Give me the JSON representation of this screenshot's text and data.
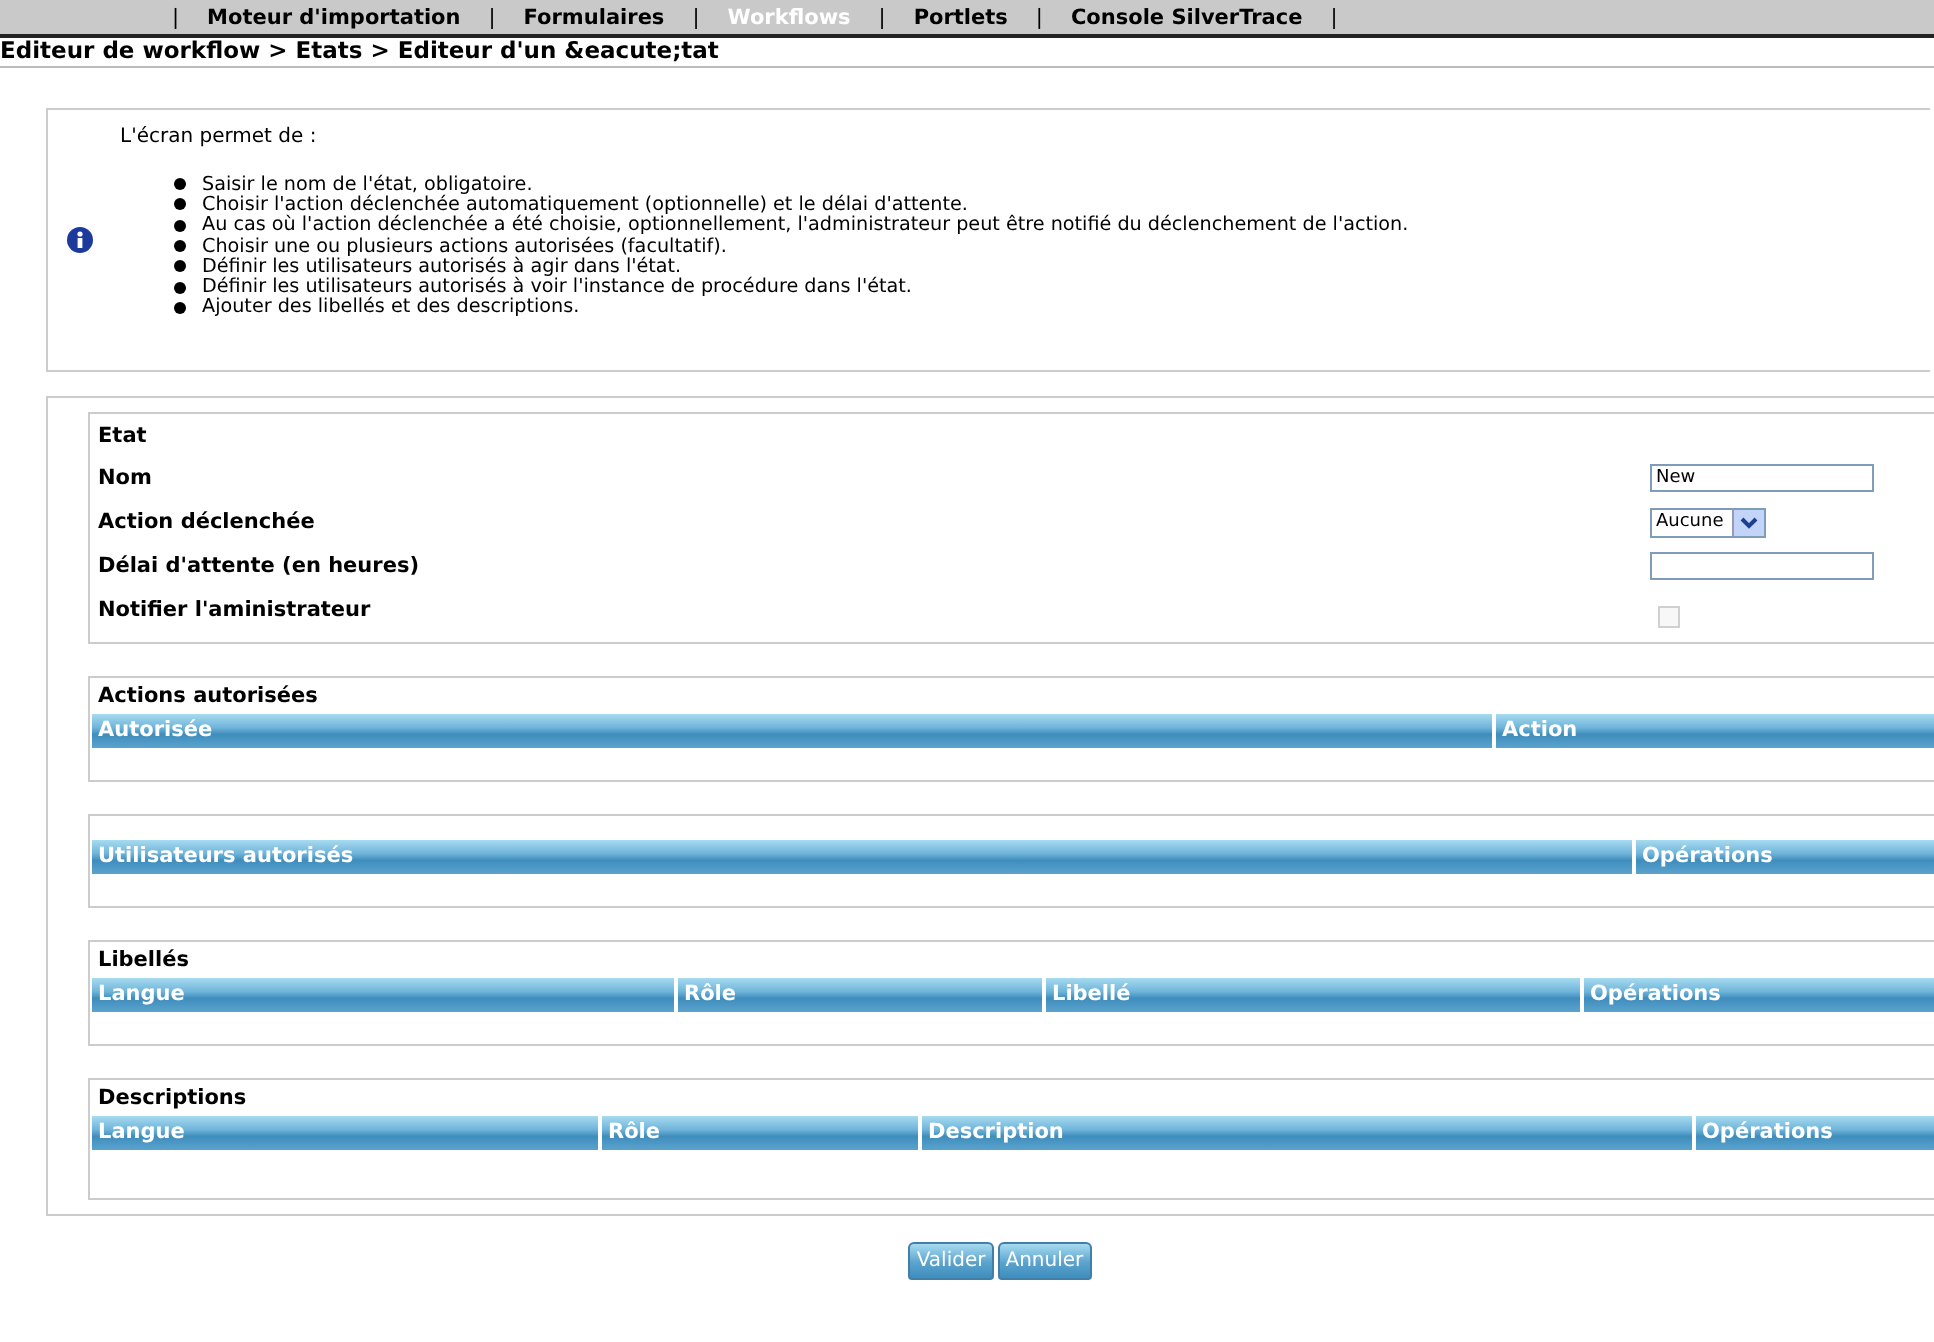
{
  "nav": [
    {
      "kind": "separator",
      "label": "|"
    },
    {
      "kind": "tab",
      "label": "Moteur d'importation",
      "selected": false
    },
    {
      "kind": "separator",
      "label": "|"
    },
    {
      "kind": "tab",
      "label": "Formulaires",
      "selected": false
    },
    {
      "kind": "separator",
      "label": "|"
    },
    {
      "kind": "tab",
      "label": "Workflows",
      "selected": true
    },
    {
      "kind": "separator",
      "label": "|"
    },
    {
      "kind": "tab",
      "label": "Portlets",
      "selected": false
    },
    {
      "kind": "separator",
      "label": "|"
    },
    {
      "kind": "tab",
      "label": "Console SilverTrace",
      "selected": false
    },
    {
      "kind": "separator",
      "label": "|"
    }
  ],
  "breadcrumb": "Editeur de workflow > Etats > Editeur d'un &eacute;tat",
  "info": {
    "intro": "L'écran permet de :",
    "bullets": [
      "Saisir le nom de l'état, obligatoire.",
      "Choisir l'action déclenchée automatiquement (optionnelle) et le délai d'attente.",
      "Au cas où l'action déclenchée a été choisie, optionnellement, l'administrateur peut être notifié du déclenchement de l'action.",
      "Choisir une ou plusieurs actions autorisées (facultatif).",
      "Définir les utilisateurs autorisés à agir dans l'état.",
      "Définir les utilisateurs autorisés à voir l'instance de procédure dans l'état.",
      "Ajouter des libellés et des descriptions."
    ]
  },
  "etat": {
    "title": "Etat",
    "fields": [
      {
        "kind": "text",
        "label": "Nom",
        "value": "New"
      },
      {
        "kind": "select",
        "label": "Action déclenchée",
        "value": "Aucune"
      },
      {
        "kind": "text",
        "label": "Délai d'attente (en heures)"
      },
      {
        "kind": "checkbox",
        "label": "Notifier l'aministrateur",
        "checked": false,
        "disabled": true
      }
    ]
  },
  "tables": [
    {
      "title": "Actions autorisées",
      "columns": [
        "Autorisée",
        "Action"
      ]
    },
    {
      "columns": [
        "Utilisateurs autorisés",
        "Opérations"
      ]
    },
    {
      "title": "Libellés",
      "columns": [
        "Langue",
        "Rôle",
        "Libellé",
        "Opérations"
      ]
    },
    {
      "title": "Descriptions",
      "columns": [
        "Langue",
        "Rôle",
        "Description",
        "Opérations"
      ]
    }
  ],
  "buttons": [
    "Valider",
    "Annuler"
  ]
}
